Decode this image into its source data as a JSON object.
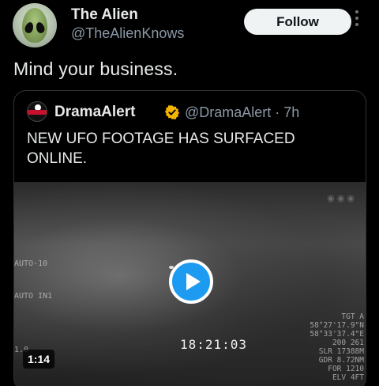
{
  "author": {
    "display_name": "The Alien",
    "handle": "@TheAlienKnows",
    "avatar": "alien-avatar"
  },
  "follow_label": "Follow",
  "tweet_text": "Mind your business.",
  "quoted": {
    "display_name": "DramaAlert",
    "handle_time": "@DramaAlert · 7h",
    "text": "NEW UFO FOOTAGE HAS SURFACED ONLINE.",
    "verified_badge_color": "#f4b400",
    "video": {
      "timestamp": "18:21:03",
      "duration": "1:14",
      "hud_left_1": "AUTO-10",
      "hud_left_2": "AUTO IN1",
      "hud_left_3": "1.0",
      "hud_right": "TGT A\n58°27'17.9\"N\n58°33'37.4\"E\n200 261\nSLR 17388M\nGDR 8.72NM\nFOR 1210\nELV 4FT",
      "play_button_color": "#1d9bf0"
    }
  },
  "colors": {
    "background": "#000000",
    "text": "#e7e9ea",
    "secondary_text": "#8b98a5",
    "follow_bg": "#eff3f4"
  }
}
